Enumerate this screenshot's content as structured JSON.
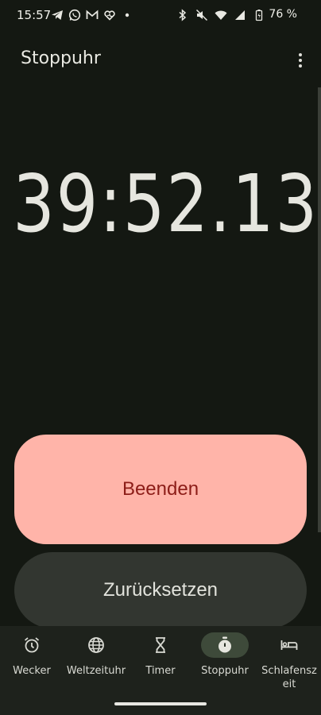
{
  "status_bar": {
    "time": "15:57",
    "left_icons": [
      "telegram-icon",
      "whatsapp-icon",
      "gmail-icon",
      "heart-app-icon",
      "dot-icon"
    ],
    "right_icons": [
      "bluetooth-icon",
      "mute-icon",
      "wifi-icon",
      "signal-icon",
      "battery-icon"
    ],
    "battery": "76 %"
  },
  "app_bar": {
    "title": "Stoppuhr"
  },
  "stopwatch": {
    "elapsed": "39:52.13"
  },
  "actions": {
    "stop_label": "Beenden",
    "reset_label": "Zurücksetzen"
  },
  "nav": {
    "items": [
      {
        "label": "Wecker",
        "icon": "alarm-icon"
      },
      {
        "label": "Weltzeituhr",
        "icon": "globe-icon"
      },
      {
        "label": "Timer",
        "icon": "hourglass-icon"
      },
      {
        "label": "Stoppuhr",
        "icon": "stopwatch-icon",
        "active": true
      },
      {
        "label": "Schlafensz\neit",
        "icon": "bed-icon"
      }
    ]
  },
  "colors": {
    "background": "#141812",
    "stop_button": "#ffb4a9",
    "stop_text": "#8c1d18",
    "reset_button": "#323630",
    "nav_active": "#3e4a3a"
  }
}
